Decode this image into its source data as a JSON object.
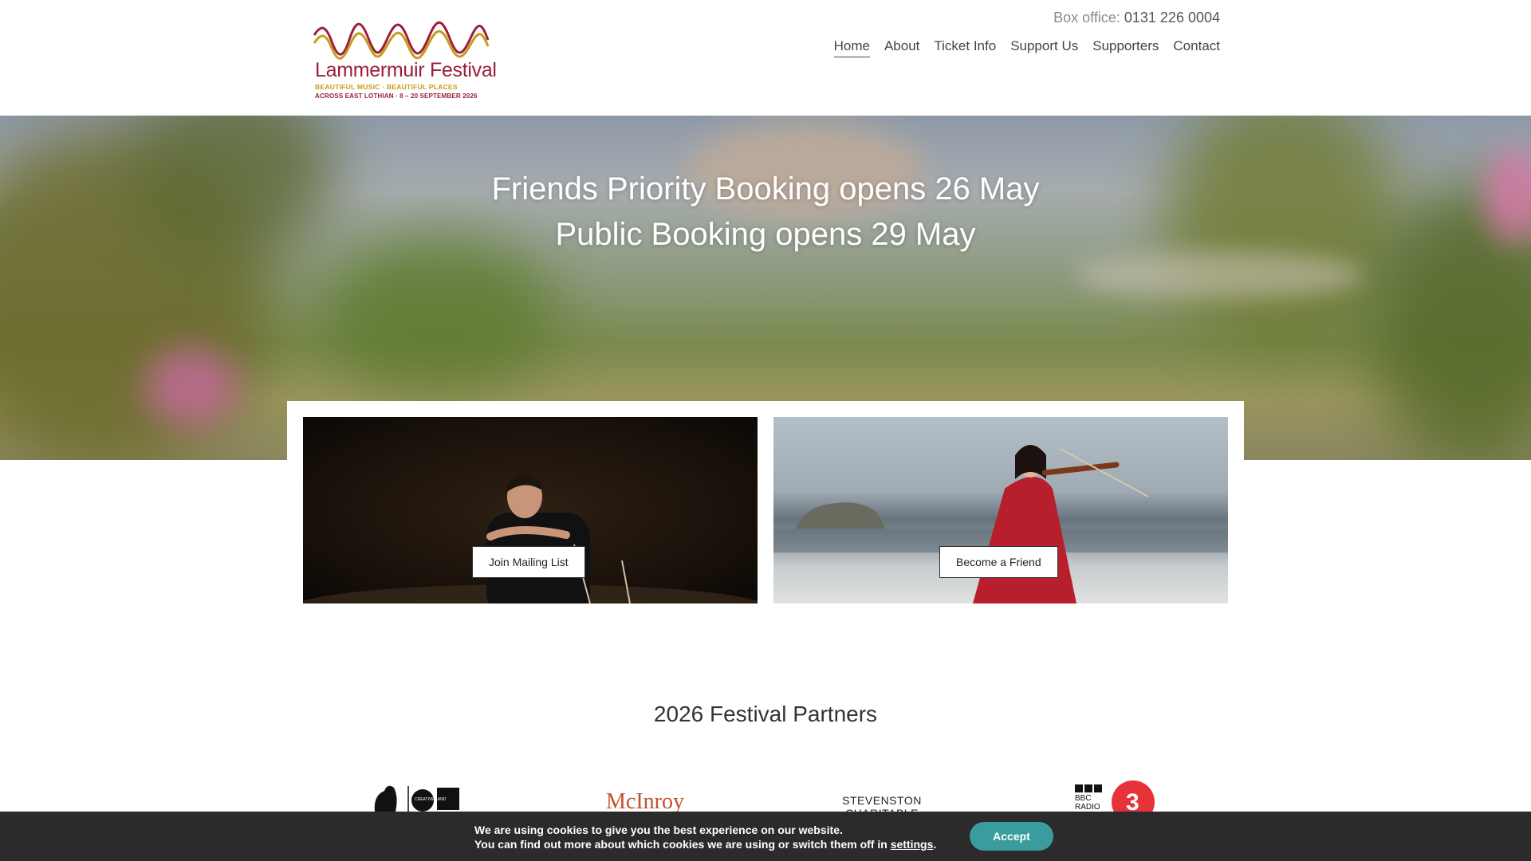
{
  "header": {
    "logo": {
      "title": "Lammermuir Festival",
      "tagline": "BEAUTIFUL MUSIC · BEAUTIFUL PLACES",
      "dates": "ACROSS EAST LOTHIAN · 8 – 20 SEPTEMBER 2026"
    },
    "box_office_label": "Box office:",
    "box_office_number": "0131 226 0004",
    "nav": [
      {
        "label": "Home",
        "active": true
      },
      {
        "label": "About"
      },
      {
        "label": "Ticket Info"
      },
      {
        "label": "Support Us"
      },
      {
        "label": "Supporters"
      },
      {
        "label": "Contact"
      }
    ]
  },
  "hero": {
    "line1": "Friends Priority Booking opens 26 May",
    "line2": "Public Booking opens 29 May"
  },
  "tiles": {
    "left_button": "Join Mailing List",
    "right_button": "Become a Friend"
  },
  "partners": {
    "title": "2026 Festival Partners",
    "logos": [
      {
        "name": "national-lottery-creative-scotland",
        "text": "CREATIVE LAND"
      },
      {
        "name": "mcinroy",
        "text": "McInroy"
      },
      {
        "name": "stevenston-charitable-trust",
        "text": "STEVENSTON CHARITABLE TRUST"
      },
      {
        "name": "bbc-radio-3",
        "text": "BBC RADIO"
      }
    ]
  },
  "cookie": {
    "line1": "We are using cookies to give you the best experience on our website.",
    "line2_prefix": "You can find out more about which cookies we are using or switch them off in",
    "settings_link": "settings",
    "line2_suffix": ".",
    "accept_label": "Accept"
  },
  "colors": {
    "brand_red": "#9b1f3c",
    "brand_gold": "#c79b1e",
    "accept_teal": "#3a9c9d",
    "cookie_bg": "#2b2b2b"
  }
}
